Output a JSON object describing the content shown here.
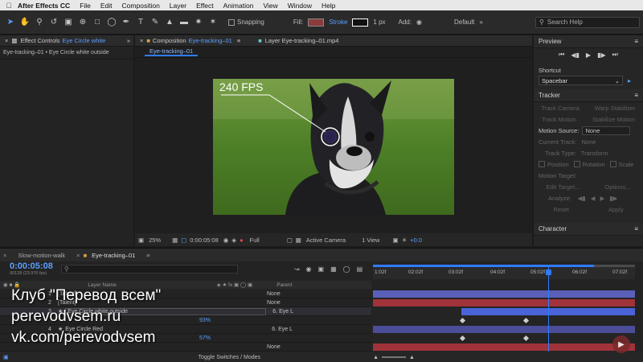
{
  "menubar": {
    "app_name": "After Effects CC",
    "items": [
      "File",
      "Edit",
      "Composition",
      "Layer",
      "Effect",
      "Animation",
      "View",
      "Window",
      "Help"
    ]
  },
  "toolbar": {
    "snapping_label": "Snapping",
    "fill_label": "Fill:",
    "stroke_label": "Stroke",
    "stroke_width": "1 px",
    "add_label": "Add:",
    "workspace": "Default",
    "search_placeholder": "Search Help"
  },
  "effect_controls": {
    "tab_prefix": "Effect Controls",
    "tab_layer": "Eye Circle white",
    "breadcrumb": "Eye-tracking–01 • Eye Circle white outside"
  },
  "composition": {
    "tab_prefix": "Composition",
    "tab_name": "Eye-tracking–01",
    "sub_tab": "Eye-tracking–01",
    "layer_tab": "Layer Eye-tracking–01.mp4",
    "overlay_text": "240 FPS",
    "zoom": "25%",
    "timecode": "0:00:05:08",
    "resolution": "Full",
    "camera": "Active Camera",
    "view": "1 View",
    "exposure": "+0.0"
  },
  "preview": {
    "title": "Preview",
    "shortcut_label": "Shortcut",
    "shortcut_value": "Spacebar"
  },
  "tracker": {
    "title": "Tracker",
    "track_camera": "Track Camera",
    "warp_stabilizer": "Warp Stabilizer",
    "track_motion": "Track Motion",
    "stabilize_motion": "Stabilize Motion",
    "motion_source_label": "Motion Source:",
    "motion_source_value": "None",
    "current_track_label": "Current Track:",
    "current_track_value": "None",
    "track_type_label": "Track Type:",
    "track_type_value": "Transform",
    "position": "Position",
    "rotation": "Rotation",
    "scale": "Scale",
    "motion_target": "Motion Target:",
    "edit_target": "Edit Target...",
    "options": "Options...",
    "analyze": "Analyze:",
    "reset": "Reset",
    "apply": "Apply"
  },
  "character": {
    "title": "Character"
  },
  "timeline": {
    "tabs": [
      "Slow-motion-walk",
      "Eye-tracking–01"
    ],
    "timecode": "0:00:05:08",
    "fps_info": "00128 (23.976 fps)",
    "ruler_marks": [
      "1:02f",
      "02:02f",
      "03:02f",
      "04:02f",
      "05:02f",
      "06:02f",
      "07:02f"
    ],
    "col_layer_name": "Layer Name",
    "col_parent": "Parent",
    "layers": [
      {
        "num": "1",
        "name": "[Talent]",
        "parent": "None"
      },
      {
        "num": "2",
        "name": "[Talent]",
        "parent": "None"
      },
      {
        "num": "3",
        "name": "Eye Circle white outside",
        "parent": "6. Eye L"
      },
      {
        "num": "",
        "name": "",
        "parent": "",
        "value": "93%"
      },
      {
        "num": "4",
        "name": "Eye Circle Red",
        "parent": "6. Eye L"
      },
      {
        "num": "",
        "name": "",
        "parent": "",
        "value": "57%"
      },
      {
        "num": "",
        "name": "",
        "parent": "None"
      }
    ],
    "footer": "Toggle Switches / Modes"
  },
  "watermark": {
    "line1": "Клуб \"Перевод всем\"",
    "line2": "perevodvsem.ru",
    "line3": "vk.com/perevodvsem"
  },
  "colors": {
    "accent": "#2f7bff",
    "bar_purple": "#5a5fb8",
    "bar_red": "#a0333a"
  }
}
